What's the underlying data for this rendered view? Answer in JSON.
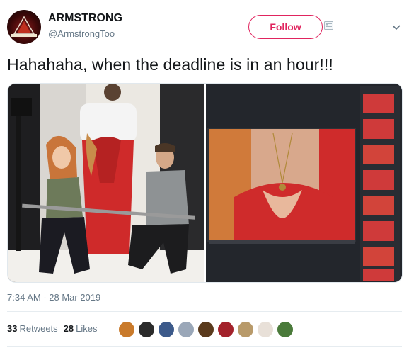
{
  "author": {
    "display_name": "ARMSTRONG",
    "handle": "@ArmstrongToo",
    "avatar_icon": "triangle-logo-avatar"
  },
  "follow_label": "Follow",
  "tweet_text": "Hahahaha, when the deadline is in an hour!!!",
  "media": {
    "left_photo": "photoshoot-studio-photo",
    "right_photo": "retouching-screen-photo"
  },
  "timestamp": "7:34 AM - 28 Mar 2019",
  "stats": {
    "retweets_count": "33",
    "retweets_label": "Retweets",
    "likes_count": "28",
    "likes_label": "Likes"
  },
  "likers": [
    {
      "name": "liker-avatar-1",
      "color": "#c97a2b"
    },
    {
      "name": "liker-avatar-2",
      "color": "#2b2b2b"
    },
    {
      "name": "liker-avatar-3",
      "color": "#3c5a8a"
    },
    {
      "name": "liker-avatar-4",
      "color": "#9aa7b8"
    },
    {
      "name": "liker-avatar-5",
      "color": "#5a3a1c"
    },
    {
      "name": "liker-avatar-6",
      "color": "#a3222b"
    },
    {
      "name": "liker-avatar-7",
      "color": "#b89a6a"
    },
    {
      "name": "liker-avatar-8",
      "color": "#e8e0d8"
    },
    {
      "name": "liker-avatar-9",
      "color": "#4a7a3a"
    }
  ],
  "colors": {
    "follow_accent": "#e0245e",
    "secondary_text": "#657786",
    "primary_text": "#14171a"
  }
}
